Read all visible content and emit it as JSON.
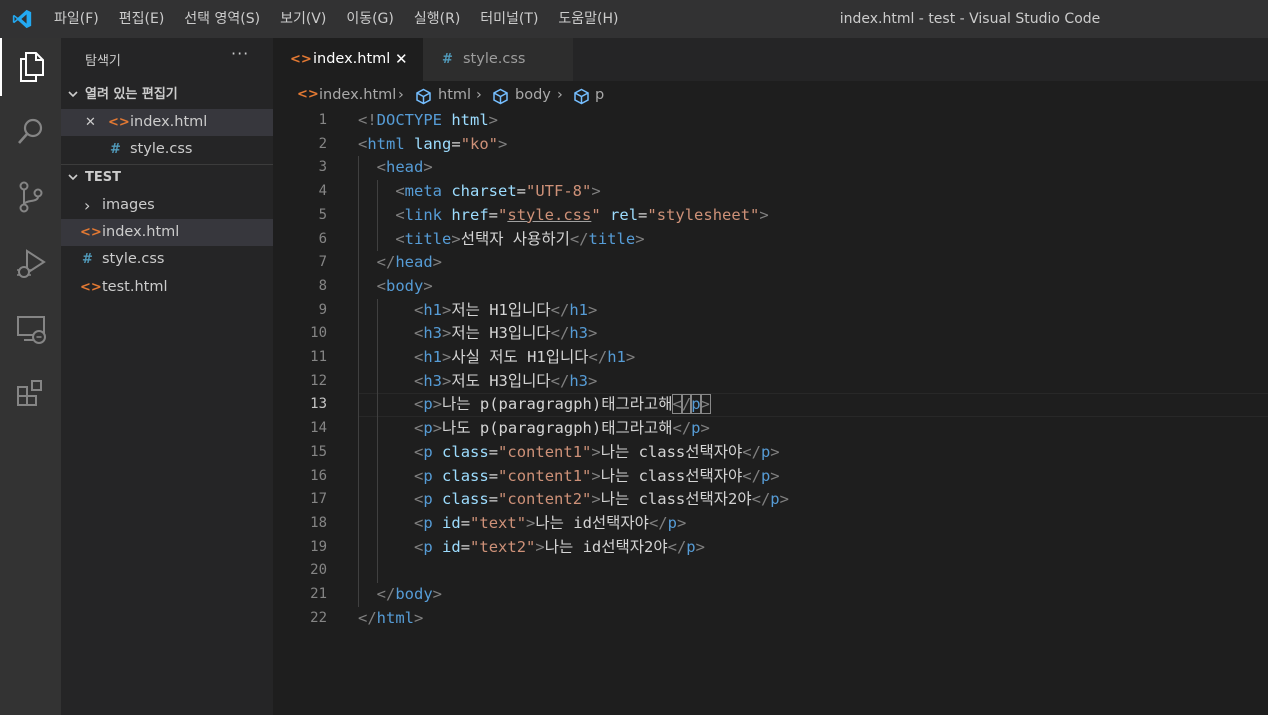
{
  "window": {
    "title": "index.html - test - Visual Studio Code",
    "menu": [
      "파일(F)",
      "편집(E)",
      "선택 영역(S)",
      "보기(V)",
      "이동(G)",
      "실행(R)",
      "터미널(T)",
      "도움말(H)"
    ]
  },
  "activity_bar": [
    "explorer-icon",
    "search-icon",
    "source-control-icon",
    "run-debug-icon",
    "remote-explorer-icon",
    "extensions-icon"
  ],
  "sidebar": {
    "title": "탐색기",
    "more": "···",
    "open_editors": {
      "label": "열려 있는 편집기",
      "items": [
        {
          "icon": "<>",
          "name": "index.html",
          "close": "✕"
        },
        {
          "icon": "#",
          "name": "style.css"
        }
      ]
    },
    "folder": {
      "label": "TEST",
      "items": [
        {
          "icon": "›",
          "name": "images"
        },
        {
          "icon": "<>",
          "name": "index.html"
        },
        {
          "icon": "#",
          "name": "style.css"
        },
        {
          "icon": "<>",
          "name": "test.html"
        }
      ]
    }
  },
  "tabs": [
    {
      "icon": "<>",
      "label": "index.html",
      "close": "✕"
    },
    {
      "icon": "#",
      "label": "style.css"
    }
  ],
  "breadcrumb": {
    "file": "index.html",
    "crumbs": [
      "html",
      "body",
      "p"
    ],
    "sep": "›"
  },
  "editor": {
    "current_line": 13,
    "lines": [
      {
        "n": 1,
        "segs": [
          [
            "t",
            "<!"
          ],
          [
            "n",
            "DOCTYPE"
          ],
          [
            "x",
            " "
          ],
          [
            "a",
            "html"
          ],
          [
            "t",
            ">"
          ]
        ]
      },
      {
        "n": 2,
        "segs": [
          [
            "t",
            "<"
          ],
          [
            "n",
            "html"
          ],
          [
            "x",
            " "
          ],
          [
            "a",
            "lang"
          ],
          [
            "x",
            "="
          ],
          [
            "s",
            "\"ko\""
          ],
          [
            "t",
            ">"
          ]
        ]
      },
      {
        "n": 3,
        "segs": [
          [
            "x",
            "  "
          ],
          [
            "t",
            "<"
          ],
          [
            "n",
            "head"
          ],
          [
            "t",
            ">"
          ]
        ]
      },
      {
        "n": 4,
        "segs": [
          [
            "x",
            "    "
          ],
          [
            "t",
            "<"
          ],
          [
            "n",
            "meta"
          ],
          [
            "x",
            " "
          ],
          [
            "a",
            "charset"
          ],
          [
            "x",
            "="
          ],
          [
            "s",
            "\"UTF-8\""
          ],
          [
            "t",
            ">"
          ]
        ]
      },
      {
        "n": 5,
        "segs": [
          [
            "x",
            "    "
          ],
          [
            "t",
            "<"
          ],
          [
            "n",
            "link"
          ],
          [
            "x",
            " "
          ],
          [
            "a",
            "href"
          ],
          [
            "x",
            "="
          ],
          [
            "s",
            "\""
          ],
          [
            "su",
            "style.css"
          ],
          [
            "s",
            "\""
          ],
          [
            "x",
            " "
          ],
          [
            "a",
            "rel"
          ],
          [
            "x",
            "="
          ],
          [
            "s",
            "\"stylesheet\""
          ],
          [
            "t",
            ">"
          ]
        ]
      },
      {
        "n": 6,
        "segs": [
          [
            "x",
            "    "
          ],
          [
            "t",
            "<"
          ],
          [
            "n",
            "title"
          ],
          [
            "t",
            ">"
          ],
          [
            "x",
            "선택자 사용하기"
          ],
          [
            "t",
            "</"
          ],
          [
            "n",
            "title"
          ],
          [
            "t",
            ">"
          ]
        ]
      },
      {
        "n": 7,
        "segs": [
          [
            "x",
            "  "
          ],
          [
            "t",
            "</"
          ],
          [
            "n",
            "head"
          ],
          [
            "t",
            ">"
          ]
        ]
      },
      {
        "n": 8,
        "segs": [
          [
            "x",
            "  "
          ],
          [
            "t",
            "<"
          ],
          [
            "n",
            "body"
          ],
          [
            "t",
            ">"
          ]
        ]
      },
      {
        "n": 9,
        "segs": [
          [
            "x",
            "      "
          ],
          [
            "t",
            "<"
          ],
          [
            "n",
            "h1"
          ],
          [
            "t",
            ">"
          ],
          [
            "x",
            "저는 H1입니다"
          ],
          [
            "t",
            "</"
          ],
          [
            "n",
            "h1"
          ],
          [
            "t",
            ">"
          ]
        ]
      },
      {
        "n": 10,
        "segs": [
          [
            "x",
            "      "
          ],
          [
            "t",
            "<"
          ],
          [
            "n",
            "h3"
          ],
          [
            "t",
            ">"
          ],
          [
            "x",
            "저는 H3입니다"
          ],
          [
            "t",
            "</"
          ],
          [
            "n",
            "h3"
          ],
          [
            "t",
            ">"
          ]
        ]
      },
      {
        "n": 11,
        "segs": [
          [
            "x",
            "      "
          ],
          [
            "t",
            "<"
          ],
          [
            "n",
            "h1"
          ],
          [
            "t",
            ">"
          ],
          [
            "x",
            "사실 저도 H1입니다"
          ],
          [
            "t",
            "</"
          ],
          [
            "n",
            "h1"
          ],
          [
            "t",
            ">"
          ]
        ]
      },
      {
        "n": 12,
        "segs": [
          [
            "x",
            "      "
          ],
          [
            "t",
            "<"
          ],
          [
            "n",
            "h3"
          ],
          [
            "t",
            ">"
          ],
          [
            "x",
            "저도 H3입니다"
          ],
          [
            "t",
            "</"
          ],
          [
            "n",
            "h3"
          ],
          [
            "t",
            ">"
          ]
        ]
      },
      {
        "n": 13,
        "segs": [
          [
            "x",
            "      "
          ],
          [
            "t",
            "<"
          ],
          [
            "n",
            "p"
          ],
          [
            "t",
            ">"
          ],
          [
            "x",
            "나는 p(paragragph)태그라고해"
          ],
          [
            "tm",
            "<"
          ],
          [
            "tm",
            "/"
          ],
          [
            "nm",
            "p"
          ],
          [
            "tm",
            ">"
          ]
        ]
      },
      {
        "n": 14,
        "segs": [
          [
            "x",
            "      "
          ],
          [
            "t",
            "<"
          ],
          [
            "n",
            "p"
          ],
          [
            "t",
            ">"
          ],
          [
            "x",
            "나도 p(paragragph)태그라고해"
          ],
          [
            "t",
            "</"
          ],
          [
            "n",
            "p"
          ],
          [
            "t",
            ">"
          ]
        ]
      },
      {
        "n": 15,
        "segs": [
          [
            "x",
            "      "
          ],
          [
            "t",
            "<"
          ],
          [
            "n",
            "p"
          ],
          [
            "x",
            " "
          ],
          [
            "a",
            "class"
          ],
          [
            "x",
            "="
          ],
          [
            "s",
            "\"content1\""
          ],
          [
            "t",
            ">"
          ],
          [
            "x",
            "나는 class선택자야"
          ],
          [
            "t",
            "</"
          ],
          [
            "n",
            "p"
          ],
          [
            "t",
            ">"
          ]
        ]
      },
      {
        "n": 16,
        "segs": [
          [
            "x",
            "      "
          ],
          [
            "t",
            "<"
          ],
          [
            "n",
            "p"
          ],
          [
            "x",
            " "
          ],
          [
            "a",
            "class"
          ],
          [
            "x",
            "="
          ],
          [
            "s",
            "\"content1\""
          ],
          [
            "t",
            ">"
          ],
          [
            "x",
            "나는 class선택자야"
          ],
          [
            "t",
            "</"
          ],
          [
            "n",
            "p"
          ],
          [
            "t",
            ">"
          ]
        ]
      },
      {
        "n": 17,
        "segs": [
          [
            "x",
            "      "
          ],
          [
            "t",
            "<"
          ],
          [
            "n",
            "p"
          ],
          [
            "x",
            " "
          ],
          [
            "a",
            "class"
          ],
          [
            "x",
            "="
          ],
          [
            "s",
            "\"content2\""
          ],
          [
            "t",
            ">"
          ],
          [
            "x",
            "나는 class선택자2야"
          ],
          [
            "t",
            "</"
          ],
          [
            "n",
            "p"
          ],
          [
            "t",
            ">"
          ]
        ]
      },
      {
        "n": 18,
        "segs": [
          [
            "x",
            "      "
          ],
          [
            "t",
            "<"
          ],
          [
            "n",
            "p"
          ],
          [
            "x",
            " "
          ],
          [
            "a",
            "id"
          ],
          [
            "x",
            "="
          ],
          [
            "s",
            "\"text\""
          ],
          [
            "t",
            ">"
          ],
          [
            "x",
            "나는 id선택자야"
          ],
          [
            "t",
            "</"
          ],
          [
            "n",
            "p"
          ],
          [
            "t",
            ">"
          ]
        ]
      },
      {
        "n": 19,
        "segs": [
          [
            "x",
            "      "
          ],
          [
            "t",
            "<"
          ],
          [
            "n",
            "p"
          ],
          [
            "x",
            " "
          ],
          [
            "a",
            "id"
          ],
          [
            "x",
            "="
          ],
          [
            "s",
            "\"text2\""
          ],
          [
            "t",
            ">"
          ],
          [
            "x",
            "나는 id선택자2야"
          ],
          [
            "t",
            "</"
          ],
          [
            "n",
            "p"
          ],
          [
            "t",
            ">"
          ]
        ]
      },
      {
        "n": 20,
        "segs": []
      },
      {
        "n": 21,
        "segs": [
          [
            "x",
            "  "
          ],
          [
            "t",
            "</"
          ],
          [
            "n",
            "body"
          ],
          [
            "t",
            ">"
          ]
        ]
      },
      {
        "n": 22,
        "segs": [
          [
            "t",
            "</"
          ],
          [
            "n",
            "html"
          ],
          [
            "t",
            ">"
          ]
        ]
      }
    ]
  }
}
